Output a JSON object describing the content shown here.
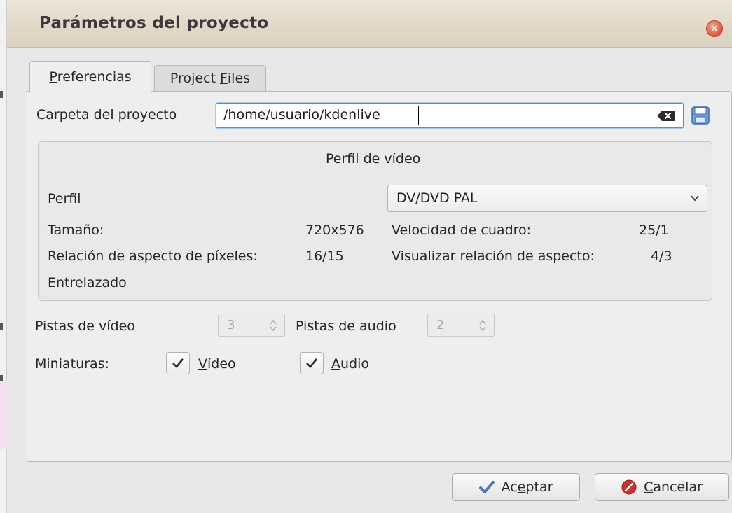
{
  "dialog": {
    "title": "Parámetros del proyecto",
    "close_symbol": "×"
  },
  "tabs": [
    {
      "label_first": "P",
      "label_rest": "referencias",
      "active": true
    },
    {
      "label_before": "Project ",
      "label_mnemonic": "F",
      "label_after": "iles",
      "active": false
    }
  ],
  "folder": {
    "label": "Carpeta del proyecto",
    "value": "/home/usuario/kdenlive",
    "clear_icon": "clear-text-icon",
    "save_icon": "floppy-disk-icon"
  },
  "profile_group": {
    "title": "Perfil de vídeo",
    "profile_label": "Perfil",
    "profile_value": "DV/DVD PAL",
    "size_label": "Tamaño:",
    "size_value": "720x576",
    "framerate_label": "Velocidad de cuadro:",
    "framerate_value": "25/1",
    "pixel_aspect_label": "Relación de aspecto de píxeles:",
    "pixel_aspect_value": "16/15",
    "display_aspect_label": "Visualizar relación de aspecto:",
    "display_aspect_value": "4/3",
    "interlaced_label": "Entrelazado"
  },
  "tracks": {
    "video_label": "Pistas de vídeo",
    "video_value": "3",
    "audio_label": "Pistas de audio",
    "audio_value": "2"
  },
  "thumbnails": {
    "label": "Miniaturas:",
    "video_mnemonic": "V",
    "video_rest": "ídeo",
    "video_checked": true,
    "audio_mnemonic": "A",
    "audio_rest": "udio",
    "audio_checked": true
  },
  "buttons": {
    "ok_before": "Ac",
    "ok_mnemonic": "e",
    "ok_after": "ptar",
    "cancel_mnemonic": "C",
    "cancel_after": "ancelar"
  },
  "colors": {
    "focus_border": "#4a8fd8",
    "close_button": "#e0553a",
    "ok_icon": "#4a78c2",
    "cancel_icon": "#d12f2f"
  }
}
